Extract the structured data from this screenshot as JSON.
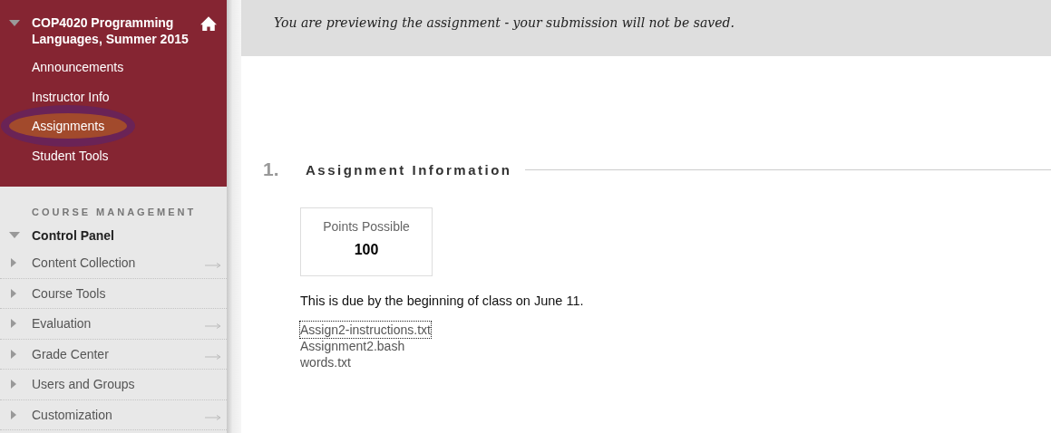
{
  "course_menu": {
    "title": "COP4020 Programming Languages, Summer 2015",
    "expanded": true,
    "items": [
      {
        "label": "Announcements",
        "circled": false
      },
      {
        "label": "Instructor Info",
        "circled": false
      },
      {
        "label": "Assignments",
        "circled": true
      },
      {
        "label": "Student Tools",
        "circled": false
      }
    ]
  },
  "management": {
    "heading": "COURSE MANAGEMENT",
    "panel_title": "Control Panel",
    "expanded": true,
    "items": [
      {
        "label": "Content Collection",
        "has_arrow": true
      },
      {
        "label": "Course Tools",
        "has_arrow": false
      },
      {
        "label": "Evaluation",
        "has_arrow": true
      },
      {
        "label": "Grade Center",
        "has_arrow": true
      },
      {
        "label": "Users and Groups",
        "has_arrow": false
      },
      {
        "label": "Customization",
        "has_arrow": true
      }
    ]
  },
  "header": {
    "subtitle": "You are previewing the assignment - your submission will not be saved."
  },
  "section": {
    "number": "1.",
    "title": "Assignment Information",
    "points": {
      "label": "Points Possible",
      "value": "100"
    },
    "instructions": "This is due by the beginning of class on June 11.",
    "files": [
      {
        "name": "Assign2-instructions.txt",
        "focused": true
      },
      {
        "name": "Assignment2.bash",
        "focused": false
      },
      {
        "name": "words.txt",
        "focused": false
      }
    ]
  }
}
